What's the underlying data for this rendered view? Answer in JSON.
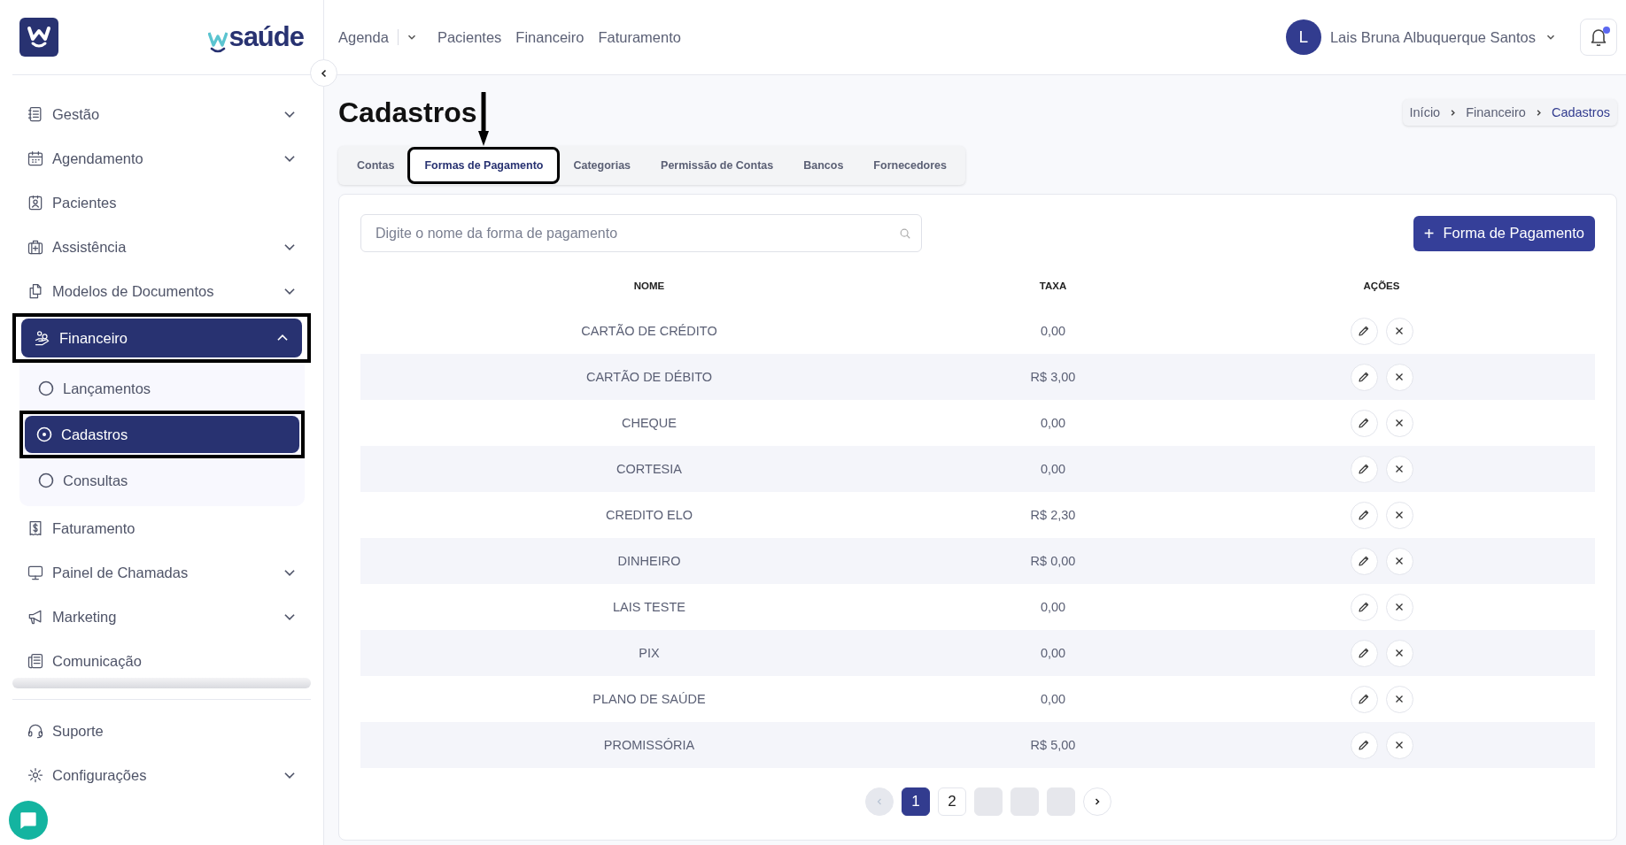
{
  "brand": {
    "name": "saúde"
  },
  "sidebar": {
    "items": [
      {
        "label": "Gestão",
        "kind": "group",
        "expanded": false,
        "selected": false,
        "highlighted": false
      },
      {
        "label": "Agendamento",
        "kind": "group",
        "expanded": false,
        "selected": false,
        "highlighted": false
      },
      {
        "label": "Pacientes",
        "kind": "link",
        "selected": false,
        "highlighted": false
      },
      {
        "label": "Assistência",
        "kind": "group",
        "expanded": false,
        "selected": false,
        "highlighted": false
      },
      {
        "label": "Modelos de Documentos",
        "kind": "group",
        "expanded": false,
        "selected": false,
        "highlighted": false
      },
      {
        "label": "Financeiro",
        "kind": "group",
        "expanded": true,
        "selected": true,
        "highlighted": true,
        "children": [
          {
            "label": "Lançamentos",
            "selected": false,
            "highlighted": false
          },
          {
            "label": "Cadastros",
            "selected": true,
            "highlighted": true
          },
          {
            "label": "Consultas",
            "selected": false,
            "highlighted": false
          }
        ]
      },
      {
        "label": "Faturamento",
        "kind": "link",
        "selected": false,
        "highlighted": false
      },
      {
        "label": "Painel de Chamadas",
        "kind": "group",
        "expanded": false,
        "selected": false,
        "highlighted": false
      },
      {
        "label": "Marketing",
        "kind": "group",
        "expanded": false,
        "selected": false,
        "highlighted": false
      },
      {
        "label": "Comunicação",
        "kind": "link",
        "selected": false,
        "highlighted": false
      }
    ],
    "footer_items": [
      {
        "label": "Suporte",
        "kind": "link"
      },
      {
        "label": "Configurações",
        "kind": "group",
        "expanded": false
      }
    ]
  },
  "top_nav": [
    {
      "label": "Agenda",
      "kind": "dropdown"
    },
    {
      "label": "Pacientes",
      "kind": "link"
    },
    {
      "label": "Financeiro",
      "kind": "link"
    },
    {
      "label": "Faturamento",
      "kind": "link"
    }
  ],
  "user": {
    "initial": "L",
    "name": "Lais Bruna Albuquerque Santos",
    "notification": true
  },
  "page": {
    "title": "Cadastros",
    "breadcrumb": [
      {
        "label": "Início",
        "selected": false
      },
      {
        "label": "Financeiro",
        "selected": false
      },
      {
        "label": "Cadastros",
        "selected": true
      }
    ]
  },
  "tabs": [
    {
      "label": "Contas",
      "selected": false,
      "highlighted": false
    },
    {
      "label": "Formas de Pagamento",
      "selected": true,
      "highlighted": true
    },
    {
      "label": "Categorias",
      "selected": false,
      "highlighted": false
    },
    {
      "label": "Permissão de Contas",
      "selected": false,
      "highlighted": false
    },
    {
      "label": "Bancos",
      "selected": false,
      "highlighted": false
    },
    {
      "label": "Fornecedores",
      "selected": false,
      "highlighted": false
    }
  ],
  "annotations": [
    {
      "kind": "arrow"
    }
  ],
  "search": {
    "placeholder": "Digite o nome da forma de pagamento"
  },
  "add_button": {
    "icon": "+",
    "label": "Forma de Pagamento"
  },
  "table": {
    "columns": [
      "NOME",
      "TAXA",
      "AÇÕES"
    ],
    "rows": [
      {
        "name": "CARTÃO DE CRÉDITO",
        "fee": "0,00"
      },
      {
        "name": "CARTÃO DE DÉBITO",
        "fee": "R$ 3,00"
      },
      {
        "name": "CHEQUE",
        "fee": "0,00"
      },
      {
        "name": "CORTESIA",
        "fee": "0,00"
      },
      {
        "name": "CREDITO ELO",
        "fee": "R$ 2,30"
      },
      {
        "name": "DINHEIRO",
        "fee": "R$ 0,00"
      },
      {
        "name": "LAIS TESTE",
        "fee": "0,00"
      },
      {
        "name": "PIX",
        "fee": "0,00"
      },
      {
        "name": "PLANO DE SAÚDE",
        "fee": "0,00"
      },
      {
        "name": "PROMISSÓRIA",
        "fee": "R$ 5,00"
      }
    ]
  },
  "pagination": {
    "prev_disabled": true,
    "pages": [
      {
        "kind": "page",
        "label": "1",
        "selected": true
      },
      {
        "kind": "page",
        "label": "2",
        "selected": false
      },
      {
        "kind": "blank"
      },
      {
        "kind": "blank"
      },
      {
        "kind": "blank"
      }
    ]
  }
}
